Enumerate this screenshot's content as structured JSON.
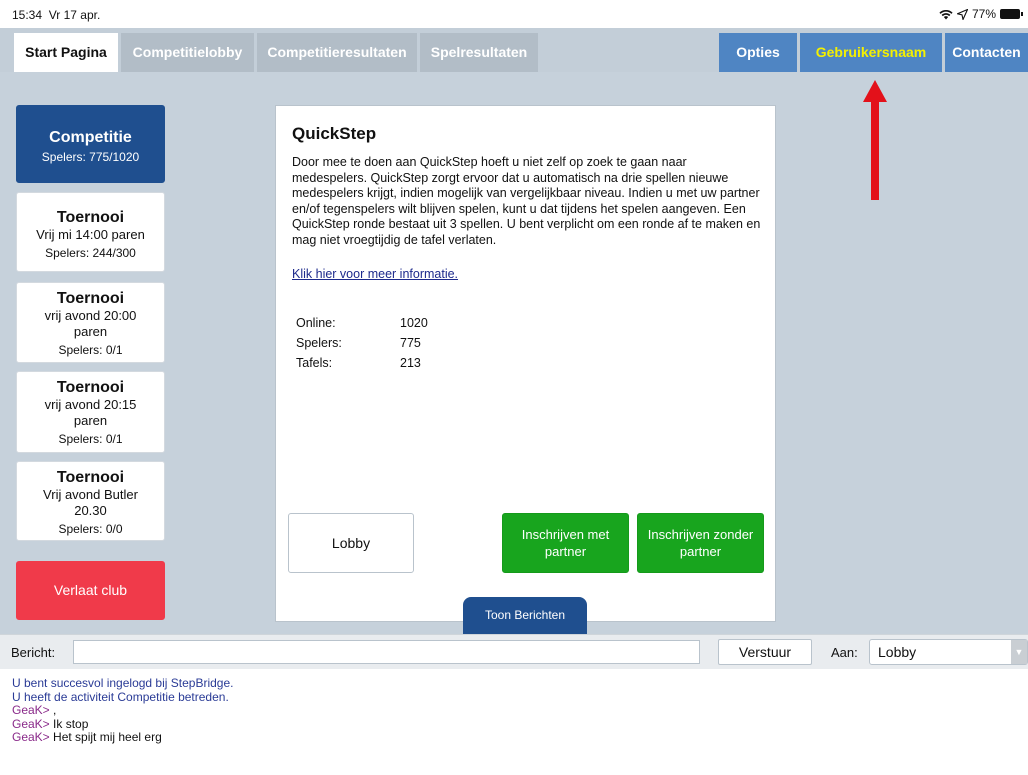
{
  "status_bar": {
    "time": "15:34",
    "date": "Vr 17 apr.",
    "battery": "77%"
  },
  "tabs": [
    {
      "label": "Start Pagina",
      "active": true
    },
    {
      "label": "Competitielobby"
    },
    {
      "label": "Competitieresultaten"
    },
    {
      "label": "Spelresultaten"
    },
    {
      "label": "Opties"
    },
    {
      "label": "Gebruikersnaam"
    },
    {
      "label": "Contacten"
    }
  ],
  "sidebar": {
    "items": [
      {
        "title": "Competitie",
        "sub": "",
        "players": "Spelers: 775/1020"
      },
      {
        "title": "Toernooi",
        "sub": "Vrij mi 14:00 paren",
        "players": "Spelers: 244/300"
      },
      {
        "title": "Toernooi",
        "sub": "vrij avond 20:00 paren",
        "players": "Spelers: 0/1"
      },
      {
        "title": "Toernooi",
        "sub": "vrij avond 20:15 paren",
        "players": "Spelers: 0/1"
      },
      {
        "title": "Toernooi",
        "sub": "Vrij avond Butler 20.30",
        "players": "Spelers: 0/0"
      }
    ],
    "leave_label": "Verlaat club"
  },
  "panel": {
    "title": "QuickStep",
    "description": "Door mee te doen aan QuickStep hoeft u niet zelf op zoek te gaan naar medespelers. QuickStep zorgt ervoor dat u automatisch na drie spellen nieuwe medespelers krijgt, indien mogelijk van vergelijkbaar niveau. Indien u met uw partner en/of tegenspelers wilt blijven spelen, kunt u dat tijdens het spelen aangeven. Een QuickStep ronde bestaat uit 3 spellen. U bent verplicht om een ronde af te maken en mag niet vroegtijdig de tafel verlaten.",
    "link": "Klik hier voor meer informatie.",
    "stats": [
      {
        "label": "Online:",
        "value": "1020"
      },
      {
        "label": "Spelers:",
        "value": "775"
      },
      {
        "label": "Tafels:",
        "value": "213"
      }
    ],
    "lobby_button": "Lobby",
    "with_partner_button": "Inschrijven met partner",
    "without_partner_button": "Inschrijven zonder partner"
  },
  "show_messages_button": "Toon Berichten",
  "message_bar": {
    "label": "Bericht:",
    "input_value": "",
    "send_label": "Verstuur",
    "to_label": "Aan:",
    "to_value": "Lobby"
  },
  "chat_log": [
    {
      "type": "sys",
      "text": "U bent succesvol ingelogd bij StepBridge."
    },
    {
      "type": "sys",
      "text": "U heeft de activiteit Competitie betreden."
    },
    {
      "type": "user",
      "nick": "GeaK>",
      "text": " ,"
    },
    {
      "type": "user",
      "nick": "GeaK>",
      "text": " Ik stop"
    },
    {
      "type": "user",
      "nick": "GeaK>",
      "text": " Het spijt mij heel erg"
    }
  ],
  "colors": {
    "tab_active": "#ffffff",
    "tab_inactive": "#b2bdc7",
    "tab_blue": "#4f85c3",
    "username_text": "#f4f000",
    "selected_item": "#1f4f8f",
    "leave_button": "#f03a4a",
    "green_button": "#18a51e",
    "arrow": "#e3111a"
  },
  "icons": [
    "wifi-icon",
    "location-icon",
    "battery-icon",
    "red-arrow-annotation",
    "dropdown-caret-icon"
  ]
}
